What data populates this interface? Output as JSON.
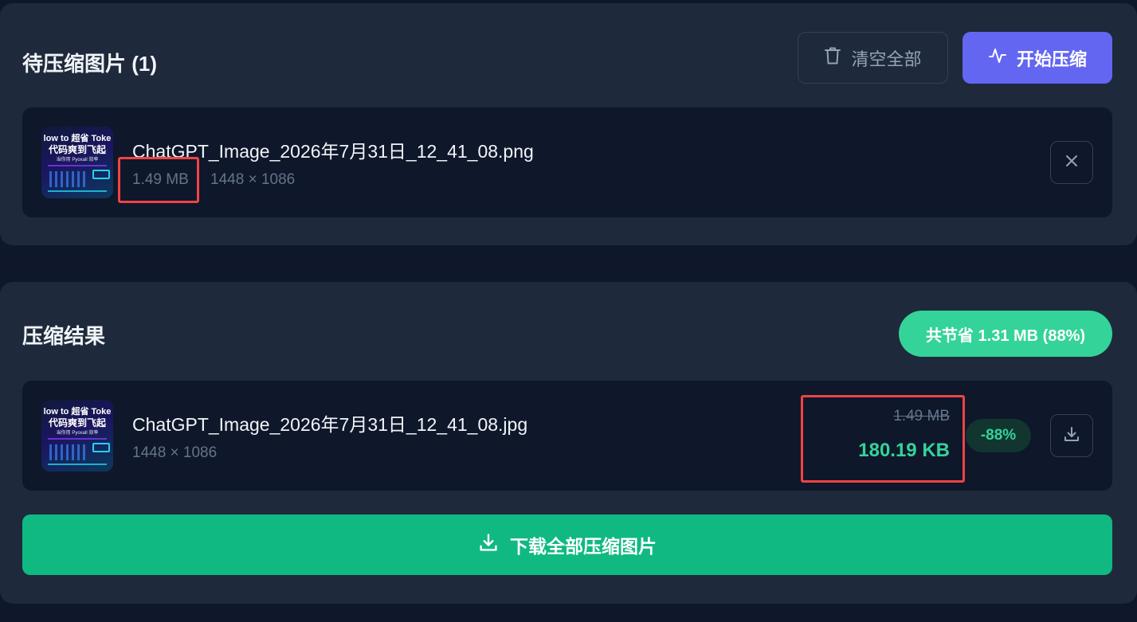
{
  "pending": {
    "title": "待压缩图片 (1)",
    "clear_label": "清空全部",
    "start_label": "开始压缩",
    "file": {
      "name": "ChatGPT_Image_2026年7月31日_12_41_08.png",
      "size": "1.49 MB",
      "dimensions": "1448 × 1086",
      "thumb_line1": "low to 超省 Toke",
      "thumb_line2": "代码爽到飞起",
      "thumb_line3": "当你用 Pyoxall 效率"
    }
  },
  "results": {
    "title": "压缩结果",
    "savings": "共节省 1.31 MB (88%)",
    "file": {
      "name": "ChatGPT_Image_2026年7月31日_12_41_08.jpg",
      "dimensions": "1448 × 1086",
      "original_size": "1.49 MB",
      "compressed_size": "180.19 KB",
      "reduction": "-88%",
      "thumb_line1": "low to 超省 Toke",
      "thumb_line2": "代码爽到飞起",
      "thumb_line3": "当你用 Pyoxall 效率"
    },
    "download_all_label": "下载全部压缩图片"
  },
  "icons": {
    "clear": "trash-icon",
    "start": "activity-icon",
    "remove": "close-icon",
    "download": "download-icon",
    "download_all": "download-icon"
  },
  "colors": {
    "background": "#0f172a",
    "card": "#1e293b",
    "primary": "#6366f1",
    "success": "#10b981",
    "success_light": "#34d399",
    "highlight": "#ef4444"
  }
}
